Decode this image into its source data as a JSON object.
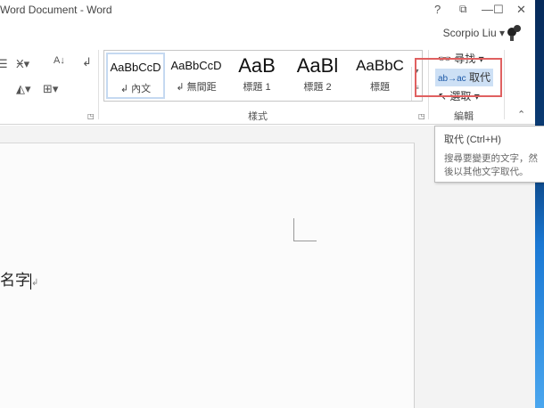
{
  "window": {
    "title": "Word Document - Word",
    "help": "?",
    "ribbon_display": "⧉",
    "minimize": "—",
    "maximize": "☐",
    "close": "✕"
  },
  "user": {
    "name": "Scorpio Liu ▾"
  },
  "ribbon": {
    "paragraph_icons": [
      "align-icon",
      "text-effects-icon",
      "sort-icon",
      "show-marks-icon",
      "shading-icon",
      "borders-icon"
    ],
    "styles_group": {
      "label": "樣式",
      "items": [
        {
          "sample": "AaBbCcD",
          "name": "↲ 內文",
          "selected": true
        },
        {
          "sample": "AaBbCcD",
          "name": "↲ 無間距"
        },
        {
          "sample": "AaB",
          "name": "標題 1"
        },
        {
          "sample": "AaBl",
          "name": "標題 2"
        },
        {
          "sample": "AaBbC",
          "name": "標題"
        }
      ]
    },
    "editing_group": {
      "label": "編輯",
      "find": "尋找 ▾",
      "replace": "取代",
      "select": "選取 ▾"
    }
  },
  "tooltip": {
    "title": "取代 (Ctrl+H)",
    "desc_line1": "搜尋要變更的文字，然",
    "desc_line2": "後以其他文字取代。"
  },
  "document": {
    "text": "名字"
  },
  "colors": {
    "highlight": "#e06060",
    "selected_button": "#cde0f5",
    "desktop": "#1a78d4"
  }
}
